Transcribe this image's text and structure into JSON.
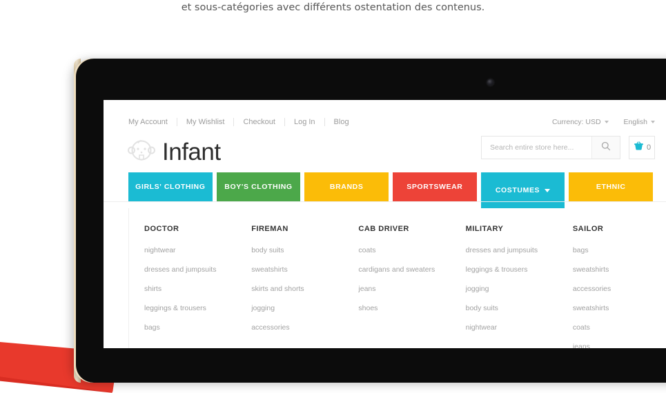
{
  "caption": "et sous-catégories avec différents ostentation des contenus.",
  "colors": {
    "cyan": "#1BBBD3",
    "green": "#4CA84A",
    "yellow": "#FBBC08",
    "red": "#ED4338",
    "device_body": "#0C0C0C",
    "device_edge": "#EFDCB8",
    "accent_red_swoosh": "#E8392C"
  },
  "device": {
    "camera_icon": "camera-lens-icon"
  },
  "site": {
    "top_links": [
      {
        "label": "My Account"
      },
      {
        "label": "My Wishlist"
      },
      {
        "label": "Checkout"
      },
      {
        "label": "Log In"
      },
      {
        "label": "Blog"
      }
    ],
    "currency": {
      "label": "Currency: USD"
    },
    "language": {
      "label": "English"
    },
    "brand": {
      "name": "Infant",
      "logo_icon": "baby-face-icon"
    },
    "search": {
      "placeholder": "Search entire store here...",
      "value": "",
      "icon": "search-icon"
    },
    "cart": {
      "count": "0",
      "icon": "shopping-basket-icon"
    },
    "nav": [
      {
        "label": "GIRLS' CLOTHING",
        "color": "#1BBBD3",
        "active": false
      },
      {
        "label": "BOY'S CLOTHING",
        "color": "#4CA84A",
        "active": false
      },
      {
        "label": "BRANDS",
        "color": "#FBBC08",
        "active": false
      },
      {
        "label": "SPORTSWEAR",
        "color": "#ED4338",
        "active": false
      },
      {
        "label": "COSTUMES",
        "color": "#1BBBD3",
        "active": true
      },
      {
        "label": "ETHNIC",
        "color": "#FBBC08",
        "active": false
      }
    ],
    "mega_menu": {
      "columns": [
        {
          "title": "DOCTOR",
          "links": [
            {
              "label": "nightwear"
            },
            {
              "label": "dresses and jumpsuits"
            },
            {
              "label": "shirts"
            },
            {
              "label": "leggings & trousers"
            },
            {
              "label": "bags"
            }
          ]
        },
        {
          "title": "FIREMAN",
          "links": [
            {
              "label": "body suits"
            },
            {
              "label": "sweatshirts"
            },
            {
              "label": "skirts and shorts"
            },
            {
              "label": "jogging"
            },
            {
              "label": "accessories"
            }
          ]
        },
        {
          "title": "CAB DRIVER",
          "links": [
            {
              "label": "coats"
            },
            {
              "label": "cardigans and sweaters"
            },
            {
              "label": "jeans"
            },
            {
              "label": "shoes"
            }
          ]
        },
        {
          "title": "MILITARY",
          "links": [
            {
              "label": "dresses and jumpsuits"
            },
            {
              "label": "leggings & trousers"
            },
            {
              "label": "jogging"
            },
            {
              "label": "body suits"
            },
            {
              "label": "nightwear"
            }
          ]
        },
        {
          "title": "SAILOR",
          "links": [
            {
              "label": "bags"
            },
            {
              "label": "sweatshirts"
            },
            {
              "label": "accessories"
            },
            {
              "label": "sweatshirts"
            },
            {
              "label": "coats"
            },
            {
              "label": "jeans"
            }
          ]
        }
      ]
    }
  }
}
